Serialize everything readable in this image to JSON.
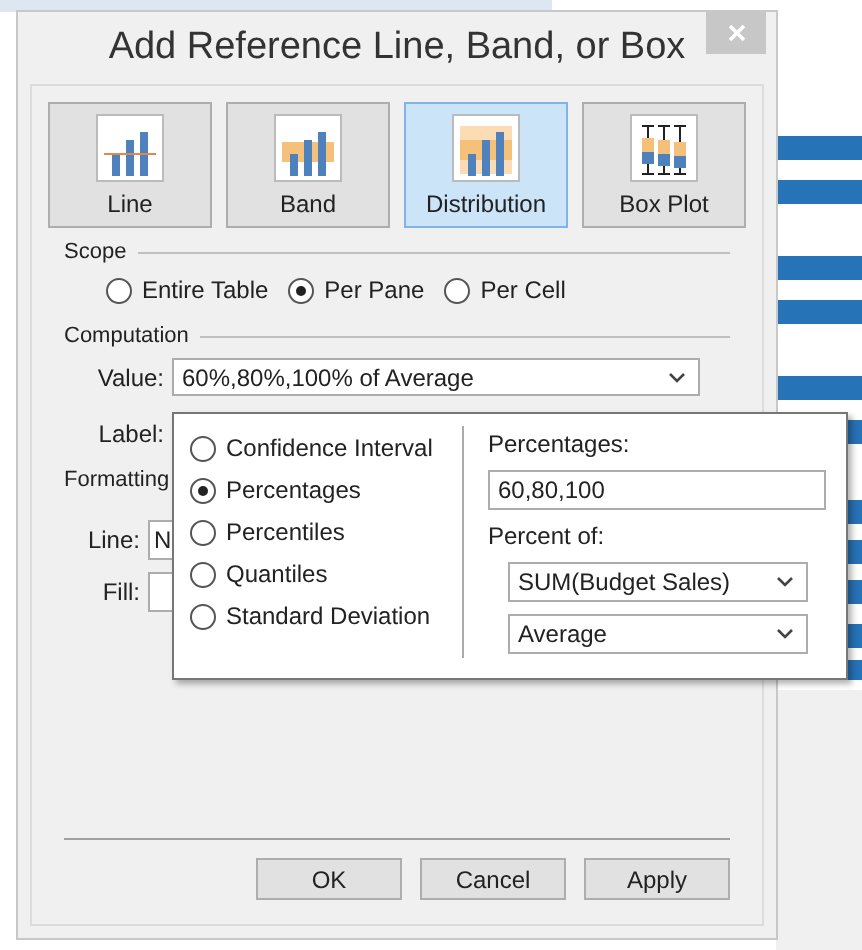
{
  "window": {
    "title": "Add Reference Line, Band, or Box"
  },
  "types": [
    {
      "label": "Line",
      "kind": "line",
      "selected": false
    },
    {
      "label": "Band",
      "kind": "band",
      "selected": false
    },
    {
      "label": "Distribution",
      "kind": "distribution",
      "selected": true
    },
    {
      "label": "Box Plot",
      "kind": "boxplot",
      "selected": false
    }
  ],
  "scope": {
    "title": "Scope",
    "options": [
      {
        "label": "Entire Table",
        "selected": false
      },
      {
        "label": "Per Pane",
        "selected": true
      },
      {
        "label": "Per Cell",
        "selected": false
      }
    ]
  },
  "computation": {
    "title": "Computation",
    "value_label": "Value:",
    "value": "60%,80%,100% of Average",
    "label_label": "Label:"
  },
  "formatting": {
    "title": "Formatting",
    "line_label": "Line:",
    "line_value": "N",
    "fill_label": "Fill:"
  },
  "popup": {
    "methods": [
      {
        "label": "Confidence Interval",
        "selected": false
      },
      {
        "label": "Percentages",
        "selected": true
      },
      {
        "label": "Percentiles",
        "selected": false
      },
      {
        "label": "Quantiles",
        "selected": false
      },
      {
        "label": "Standard Deviation",
        "selected": false
      }
    ],
    "percentages_label": "Percentages:",
    "percentages_value": "60,80,100",
    "percent_of_label": "Percent of:",
    "selects": [
      "SUM(Budget Sales)",
      "Average"
    ]
  },
  "buttons": [
    "OK",
    "Cancel",
    "Apply"
  ]
}
